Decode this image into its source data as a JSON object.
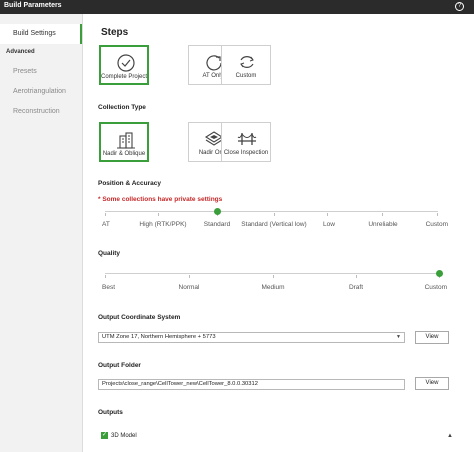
{
  "window": {
    "title": "Build Parameters",
    "help_icon": "?"
  },
  "sidebar": {
    "active": "Build Settings",
    "section_header": "Advanced",
    "items": [
      "Presets",
      "Aerotriangulation",
      "Reconstruction"
    ]
  },
  "main": {
    "title": "Steps",
    "steps": [
      {
        "label": "Complete Project",
        "icon": "check-circle-icon",
        "selected": true
      },
      {
        "label": "AT Only",
        "icon": "rotate-icon",
        "selected": false
      },
      {
        "label": "Custom",
        "icon": "custom-rotate-icon",
        "selected": false
      }
    ],
    "collection_type": {
      "label": "Collection Type",
      "options": [
        {
          "label": "Nadir & Oblique",
          "icon": "building-oblique-icon",
          "selected": true
        },
        {
          "label": "Nadir Only",
          "icon": "layers-icon",
          "selected": false
        },
        {
          "label": "Close Inspection",
          "icon": "bridge-icon",
          "selected": false
        }
      ]
    },
    "position_accuracy": {
      "label": "Position & Accuracy",
      "warning": "* Some collections have private settings",
      "ticks": [
        "AT",
        "High (RTK/PPK)",
        "Standard",
        "Standard (Vertical low)",
        "Low",
        "Unreliable",
        "Custom"
      ],
      "selected_index": 2
    },
    "quality": {
      "label": "Quality",
      "ticks": [
        "Best",
        "Normal",
        "Medium",
        "Draft",
        "Custom"
      ],
      "selected_index": 4
    },
    "output_cs": {
      "label": "Output Coordinate System",
      "value": "UTM Zone 17, Northern Hemisphere + 5773",
      "view_label": "View"
    },
    "output_folder": {
      "label": "Output Folder",
      "value": "Projects\\close_range\\CellTower_new\\CellTower_8.0.0.30312",
      "view_label": "View"
    },
    "outputs": {
      "label": "Outputs",
      "items": [
        {
          "label": "3D Model",
          "checked": true
        }
      ]
    }
  },
  "colors": {
    "accent": "#3a9f3a",
    "warning": "#c62828",
    "titlebar": "#2b2b2b"
  }
}
